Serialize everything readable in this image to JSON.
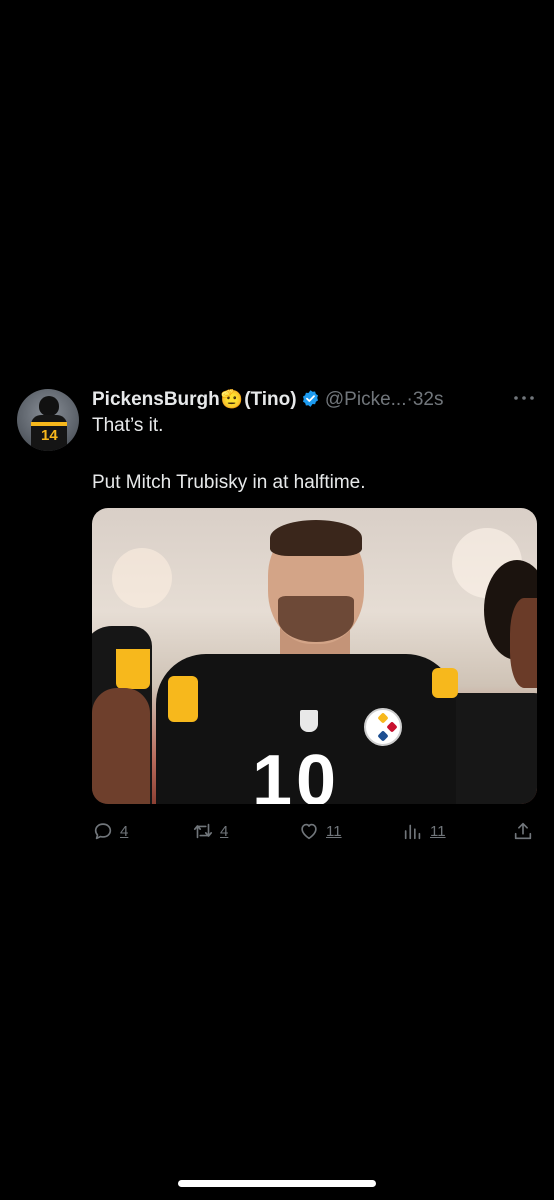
{
  "tweet": {
    "display_name": "PickensBurgh",
    "name_emoji": "🫡",
    "name_suffix": "(Tino)",
    "handle": "@Picke...",
    "separator": "·",
    "timestamp": "32s",
    "verified": true,
    "verified_color": "#1d9bf0",
    "more_icon": "more-dots-icon",
    "text_line1": "That’s it.",
    "text_line2": "Put Mitch Trubisky in at halftime.",
    "media": {
      "jersey_number": "10",
      "alt": "Steelers player wearing number 10 jersey"
    },
    "actions": {
      "replies": "4",
      "retweets": "4",
      "likes": "11",
      "views": "11",
      "reply_icon": "reply-icon",
      "retweet_icon": "retweet-icon",
      "like_icon": "heart-icon",
      "views_icon": "views-chart-icon",
      "share_icon": "share-icon"
    }
  },
  "colors": {
    "background": "#000000",
    "text": "#e7e9ea",
    "secondary": "#71767b",
    "accent": "#1d9bf0",
    "steelers_gold": "#f7b81c"
  }
}
